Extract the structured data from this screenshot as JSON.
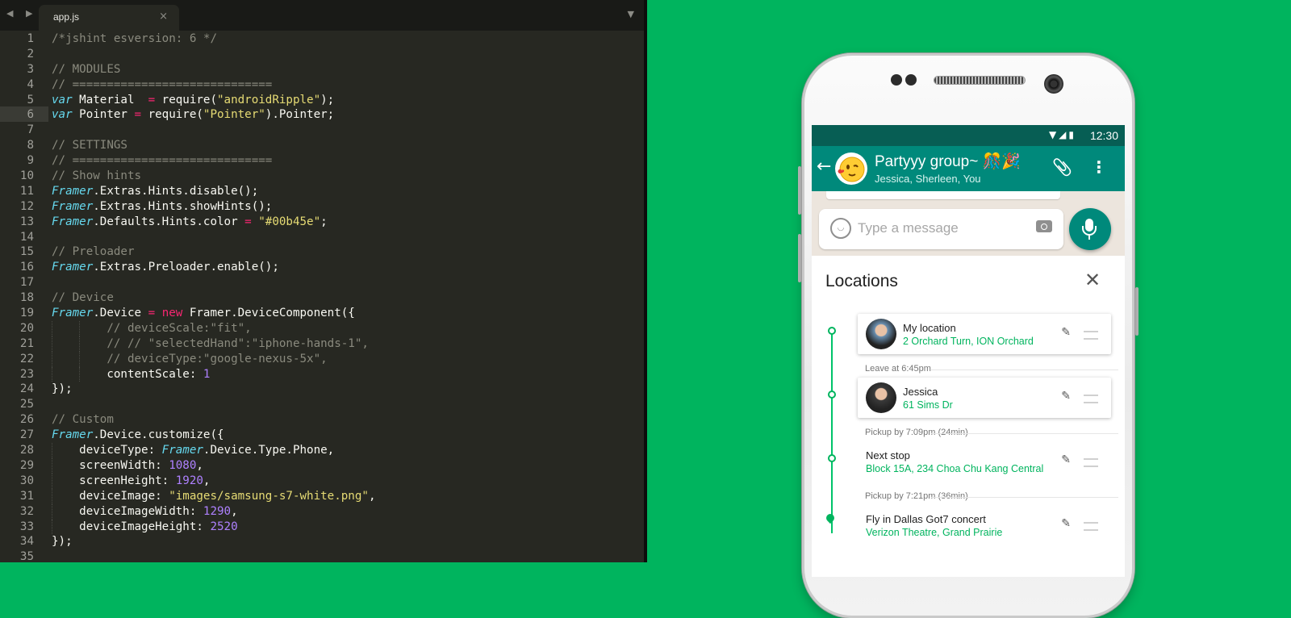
{
  "editor": {
    "nav_arrows": "◀ ▶",
    "tab_label": "app.js",
    "tab_close": "×",
    "tab_menu": "▼",
    "highlight_line": 6,
    "lines": [
      {
        "n": "1",
        "t": [
          [
            "c",
            "/*jshint esversion: 6 */"
          ]
        ]
      },
      {
        "n": "2",
        "t": []
      },
      {
        "n": "3",
        "t": [
          [
            "c",
            "// MODULES"
          ]
        ]
      },
      {
        "n": "4",
        "t": [
          [
            "c",
            "// ============================="
          ]
        ]
      },
      {
        "n": "5",
        "t": [
          [
            "k",
            "var"
          ],
          [
            "w",
            " Material  "
          ],
          [
            "o",
            "="
          ],
          [
            "w",
            " require("
          ],
          [
            "s",
            "\"androidRipple\""
          ],
          [
            "w",
            ");"
          ]
        ]
      },
      {
        "n": "6",
        "t": [
          [
            "k",
            "var"
          ],
          [
            "w",
            " Pointer "
          ],
          [
            "o",
            "="
          ],
          [
            "w",
            " require("
          ],
          [
            "s",
            "\"Pointer\""
          ],
          [
            "w",
            ").Pointer;"
          ]
        ]
      },
      {
        "n": "7",
        "t": []
      },
      {
        "n": "8",
        "t": [
          [
            "c",
            "// SETTINGS"
          ]
        ]
      },
      {
        "n": "9",
        "t": [
          [
            "c",
            "// ============================="
          ]
        ]
      },
      {
        "n": "10",
        "t": [
          [
            "c",
            "// Show hints"
          ]
        ]
      },
      {
        "n": "11",
        "t": [
          [
            "k",
            "Framer"
          ],
          [
            "w",
            ".Extras.Hints.disable();"
          ]
        ]
      },
      {
        "n": "12",
        "t": [
          [
            "k",
            "Framer"
          ],
          [
            "w",
            ".Extras.Hints.showHints();"
          ]
        ]
      },
      {
        "n": "13",
        "t": [
          [
            "k",
            "Framer"
          ],
          [
            "w",
            ".Defaults.Hints.color "
          ],
          [
            "o",
            "="
          ],
          [
            "w",
            " "
          ],
          [
            "s",
            "\"#00b45e\""
          ],
          [
            "w",
            ";"
          ]
        ]
      },
      {
        "n": "14",
        "t": []
      },
      {
        "n": "15",
        "t": [
          [
            "c",
            "// Preloader"
          ]
        ]
      },
      {
        "n": "16",
        "t": [
          [
            "k",
            "Framer"
          ],
          [
            "w",
            ".Extras.Preloader.enable();"
          ]
        ]
      },
      {
        "n": "17",
        "t": []
      },
      {
        "n": "18",
        "t": [
          [
            "c",
            "// Device"
          ]
        ]
      },
      {
        "n": "19",
        "t": [
          [
            "k",
            "Framer"
          ],
          [
            "w",
            ".Device "
          ],
          [
            "o",
            "="
          ],
          [
            "w",
            " "
          ],
          [
            "o",
            "new"
          ],
          [
            "w",
            " Framer.DeviceComponent({"
          ]
        ]
      },
      {
        "n": "20",
        "i": 2,
        "t": [
          [
            "w",
            "        "
          ],
          [
            "c",
            "// deviceScale:\"fit\","
          ]
        ]
      },
      {
        "n": "21",
        "i": 2,
        "t": [
          [
            "w",
            "        "
          ],
          [
            "c",
            "// // \"selectedHand\":\"iphone-hands-1\","
          ]
        ]
      },
      {
        "n": "22",
        "i": 2,
        "t": [
          [
            "w",
            "        "
          ],
          [
            "c",
            "// deviceType:\"google-nexus-5x\","
          ]
        ]
      },
      {
        "n": "23",
        "i": 2,
        "t": [
          [
            "w",
            "        contentScale: "
          ],
          [
            "n",
            "1"
          ]
        ]
      },
      {
        "n": "24",
        "t": [
          [
            "w",
            "});"
          ]
        ]
      },
      {
        "n": "25",
        "t": []
      },
      {
        "n": "26",
        "t": [
          [
            "c",
            "// Custom"
          ]
        ]
      },
      {
        "n": "27",
        "t": [
          [
            "k",
            "Framer"
          ],
          [
            "w",
            ".Device.customize({"
          ]
        ]
      },
      {
        "n": "28",
        "i": 1,
        "t": [
          [
            "w",
            "    deviceType: "
          ],
          [
            "k",
            "Framer"
          ],
          [
            "w",
            ".Device.Type.Phone,"
          ]
        ]
      },
      {
        "n": "29",
        "i": 1,
        "t": [
          [
            "w",
            "    screenWidth: "
          ],
          [
            "n",
            "1080"
          ],
          [
            "w",
            ","
          ]
        ]
      },
      {
        "n": "30",
        "i": 1,
        "t": [
          [
            "w",
            "    screenHeight: "
          ],
          [
            "n",
            "1920"
          ],
          [
            "w",
            ","
          ]
        ]
      },
      {
        "n": "31",
        "i": 1,
        "t": [
          [
            "w",
            "    deviceImage: "
          ],
          [
            "s",
            "\"images/samsung-s7-white.png\""
          ],
          [
            "w",
            ","
          ]
        ]
      },
      {
        "n": "32",
        "i": 1,
        "t": [
          [
            "w",
            "    deviceImageWidth: "
          ],
          [
            "n",
            "1290"
          ],
          [
            "w",
            ","
          ]
        ]
      },
      {
        "n": "33",
        "i": 1,
        "t": [
          [
            "w",
            "    deviceImageHeight: "
          ],
          [
            "n",
            "2520"
          ]
        ]
      },
      {
        "n": "34",
        "t": [
          [
            "w",
            "});"
          ]
        ]
      },
      {
        "n": "35",
        "t": []
      }
    ]
  },
  "phone": {
    "status": {
      "icons": "▼◢▮",
      "time": "12:30"
    },
    "appbar": {
      "back_glyph": "←",
      "title": "Partyyy group~ 🎊🎉",
      "subtitle": "Jessica, Sherleen, You",
      "attach_glyph": "📎",
      "menu_glyph": "⋮",
      "avatar_emoji": "😘"
    },
    "composer": {
      "placeholder": "Type a message",
      "emoji_glyph": "◡"
    },
    "panel": {
      "title": "Locations",
      "close_glyph": "✕",
      "edit_glyph": "✎",
      "stops": [
        {
          "name": "My location",
          "address": "2 Orchard Turn, ION Orchard",
          "photo": true,
          "raised": true,
          "avatar_color": "#6a8fb0"
        },
        {
          "name": "Jessica",
          "address": "61 Sims Dr",
          "photo": true,
          "raised": true,
          "avatar_color": "#3a3a3a"
        },
        {
          "name": "Next stop",
          "address": "Block 15A, 234 Choa Chu Kang Central",
          "photo": false,
          "raised": false
        },
        {
          "name": "Fly in Dallas Got7 concert",
          "address": "Verizon Theatre, Grand Prairie",
          "photo": false,
          "raised": false
        }
      ],
      "legs": [
        "Leave at 6:45pm",
        "Pickup by 7:09pm (24min)",
        "Pickup by 7:21pm (36min)"
      ]
    },
    "colors": {
      "header": "#00897b",
      "accent": "#00b45e",
      "statusbar": "#075e54"
    }
  }
}
